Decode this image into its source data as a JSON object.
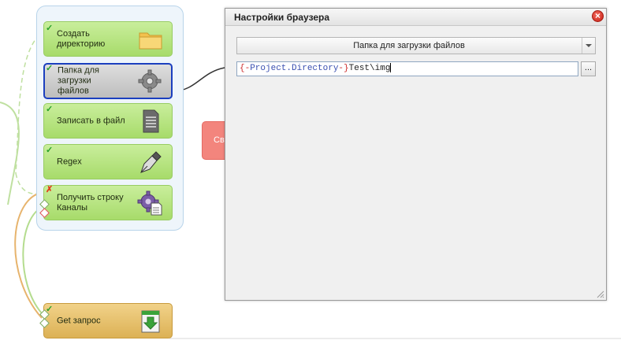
{
  "canvas": {
    "nodes": [
      {
        "label": "Создать\nдиректорию",
        "status": "ok",
        "icon": "folder-icon"
      },
      {
        "label": "Папка для загрузки\nфайлов",
        "status": "ok",
        "icon": "gear-icon",
        "selected": true
      },
      {
        "label": "Записать в файл",
        "status": "ok",
        "icon": "document-icon"
      },
      {
        "label": "Regex",
        "status": "ok",
        "icon": "pen-nib-icon"
      },
      {
        "label": "Получить строку\nКаналы",
        "status": "error",
        "icon": "gear-document-icon"
      },
      {
        "label": "Get запрос",
        "status": "ok",
        "icon": "download-arrow-icon"
      }
    ],
    "partial_node_text": "Св",
    "status_ok_glyph": "✓",
    "status_err_glyph": "✗"
  },
  "dialog": {
    "title": "Настройки браузера",
    "close_glyph": "×",
    "action_select": {
      "value": "Папка для загрузки файлов"
    },
    "path_field": {
      "value": "{-Project.Directory-}Test\\img",
      "tokens": {
        "open": "{-",
        "variable": "Project.Directory",
        "close": "-}",
        "literal": "Test\\img"
      }
    },
    "browse_label": "..."
  },
  "colors": {
    "node_green": "#b6e37f",
    "node_selected_border": "#1b3fbf",
    "node_orange": "#e6c06b",
    "dialog_bg": "#f0f0f0",
    "close_red": "#d9281d"
  }
}
